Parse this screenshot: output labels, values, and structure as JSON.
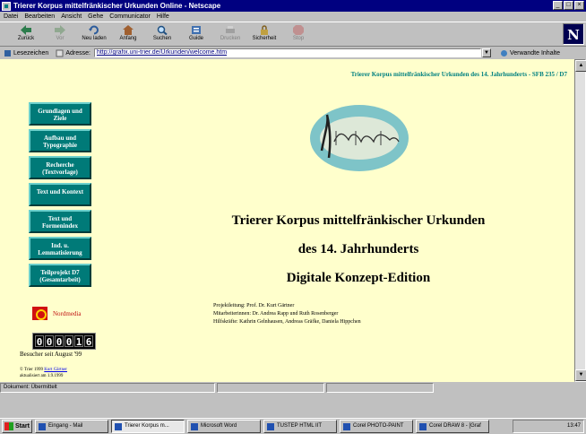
{
  "window": {
    "title": "Trierer Korpus mittelfränkischer Urkunden Online - Netscape"
  },
  "menu": {
    "items": [
      "Datei",
      "Bearbeiten",
      "Ansicht",
      "Gehe",
      "Communicator",
      "Hilfe"
    ]
  },
  "toolbar": {
    "buttons": [
      "Zurück",
      "Vor",
      "Neu laden",
      "Anfang",
      "Suchen",
      "Guide",
      "Drucken",
      "Sicherheit",
      "Stop"
    ]
  },
  "location": {
    "bookmarks_label": "Lesezeichen",
    "address_label": "Adresse:",
    "address_value": "http://grafix.uni-trier.de/Urkunden/welcome.htm",
    "related_label": "Verwandte Inhalte"
  },
  "page": {
    "header": "Trierer Korpus mittelfränkischer Urkunden des 14. Jahrhunderts - SFB 235 / D7",
    "nav": [
      "Grundlagen und Ziele",
      "Aufbau und Typographie",
      "Recherche (Textvorlage)",
      "Text und Kontext",
      "Text und Formenindex",
      "Ind. u. Lemmatisierung",
      "Teilprojekt D7 (Gesamtarbeit)"
    ],
    "logo_text": "Nordmedia",
    "counter": "000016",
    "visitors": "Besucher seit August '99",
    "copyright_line1": "© Trier 1999",
    "copyright_link": "Kurt Gärtner",
    "copyright_line2": "aktualisiert am 1.9.1999",
    "title_line1": "Trierer Korpus mittelfränkischer Urkunden",
    "title_line2": "des 14. Jahrhunderts",
    "title_line3": "Digitale Konzept-Edition",
    "credit1": "Projektleitung: Prof. Dr. Kurt Gärtner",
    "credit2": "Mitarbeiterinnen: Dr. Andrea Rapp und Ruth Rosenberger",
    "credit3": "Hilfskräfte: Kathrin Gelnhausen, Andreas Gräfke, Daniela Hippchen"
  },
  "status": {
    "text": "Dokument: Übermittelt"
  },
  "taskbar": {
    "start_label": "Start",
    "tasks": [
      "Eingang - Mail",
      "Trierer Korpus m...",
      "Microsoft Word",
      "TUSTEP HTML IIT",
      "Corel PHOTO-PAINT",
      "Corel DRAW 8 - [Graf"
    ],
    "clock": "13:47"
  },
  "colors": {
    "nav_teal": "#007a78",
    "content_bg": "#ffffcc",
    "header_teal": "#008080"
  }
}
